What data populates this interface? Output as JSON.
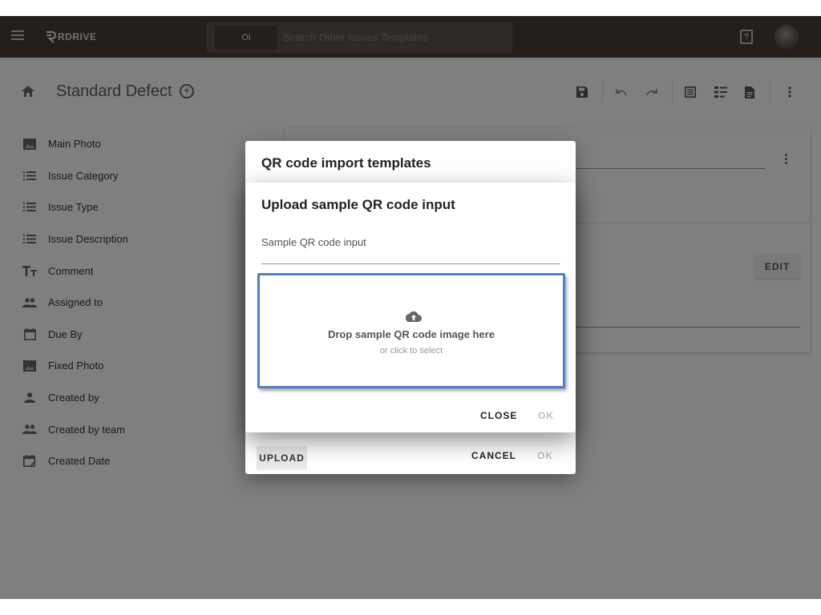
{
  "topbar": {
    "brand": "RDRIVE",
    "search_prefix": "OI",
    "search_placeholder": "Search Other Issues Templates",
    "help_glyph": "?"
  },
  "page": {
    "title": "Standard Defect"
  },
  "sidebar": {
    "items": [
      {
        "label": "Main Photo",
        "icon": "image-icon"
      },
      {
        "label": "Issue Category",
        "icon": "list-icon"
      },
      {
        "label": "Issue Type",
        "icon": "list-icon"
      },
      {
        "label": "Issue Description",
        "icon": "list-icon"
      },
      {
        "label": "Comment",
        "icon": "text-icon"
      },
      {
        "label": "Assigned to",
        "icon": "group-icon"
      },
      {
        "label": "Due By",
        "icon": "calendar-icon"
      },
      {
        "label": "Fixed Photo",
        "icon": "image-icon"
      },
      {
        "label": "Created by",
        "icon": "person-icon"
      },
      {
        "label": "Created by team",
        "icon": "group-icon"
      },
      {
        "label": "Created Date",
        "icon": "calendar-edit-icon"
      }
    ]
  },
  "card": {
    "edit_label": "EDIT"
  },
  "dialog_outer": {
    "title": "QR code import templates",
    "upload_label": "UPLOAD",
    "cancel_label": "CANCEL",
    "ok_label": "OK"
  },
  "dialog_inner": {
    "title": "Upload sample QR code input",
    "field_label": "Sample QR code input",
    "drop_title": "Drop sample QR code image here",
    "drop_subtitle": "or click to select",
    "close_label": "CLOSE",
    "ok_label": "OK"
  },
  "colors": {
    "topbar": "#4b3e38",
    "dropzone_border": "#4f7fc6"
  }
}
